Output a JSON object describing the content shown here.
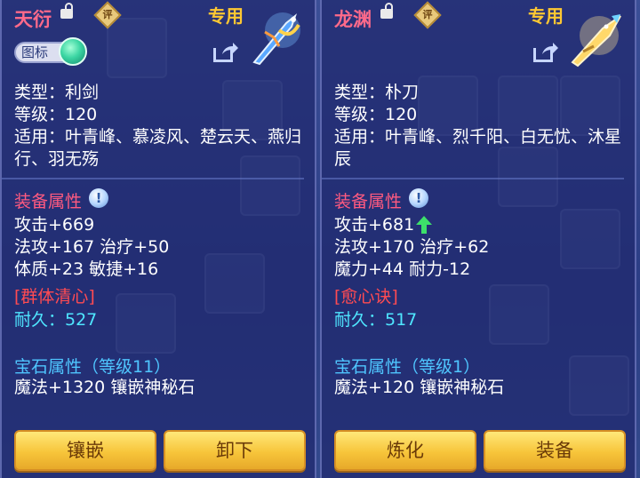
{
  "left": {
    "title": "天衍",
    "rate_label": "评",
    "exclusive_label": "专用",
    "icon_toggle_label": "图标",
    "lines": [
      "类型：利剑",
      "等级：120",
      "适用：叶青峰、慕凌风、楚云天、燕归行、羽无殇"
    ],
    "attr_header": "装备属性",
    "attrs": [
      "攻击+669",
      "法攻+167 治疗+50",
      "体质+23 敏捷+16"
    ],
    "skill": "[群体清心]",
    "durability": "耐久：527",
    "gem_header": "宝石属性（等级11）",
    "gem_line": "魔法+1320 镶嵌神秘石",
    "buttons": [
      "镶嵌",
      "卸下"
    ]
  },
  "right": {
    "title": "龙渊",
    "rate_label": "评",
    "exclusive_label": "专用",
    "lines": [
      "类型：朴刀",
      "等级：120",
      "适用：叶青峰、烈千阳、白无忧、沐星辰"
    ],
    "attr_header": "装备属性",
    "attrs": [
      "攻击+681",
      "法攻+170 治疗+62",
      "魔力+44 耐力-12"
    ],
    "skill": "[愈心诀]",
    "durability": "耐久：517",
    "gem_header": "宝石属性（等级1）",
    "gem_line": "魔法+120 镶嵌神秘石",
    "buttons": [
      "炼化",
      "装备"
    ]
  },
  "colors": {
    "title": "#ff6a8a",
    "exclusive": "#ffc832",
    "attr_header": "#ff5a80",
    "skill": "#ff4b52",
    "durability": "#4fe6ff",
    "gem_header": "#4fc6ff",
    "button": "#f7c53a"
  },
  "icons": [
    "lock-icon",
    "rate-badge-icon",
    "share-icon",
    "weapon-sword-icon",
    "weapon-blade-icon",
    "info-hint-icon",
    "up-arrow-icon"
  ]
}
